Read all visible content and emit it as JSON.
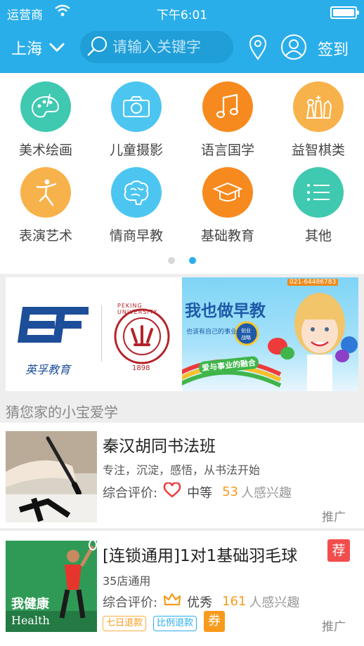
{
  "status_bar": {
    "carrier": "运营商",
    "time": "下午6:01"
  },
  "header": {
    "city": "上海",
    "search_placeholder": "请输入关键字",
    "signin": "签到"
  },
  "categories": [
    {
      "label": "美术绘画",
      "color": "#3ec9b0",
      "icon": "palette-icon"
    },
    {
      "label": "儿童摄影",
      "color": "#4cc6f0",
      "icon": "camera-icon"
    },
    {
      "label": "语言国学",
      "color": "#f78a1e",
      "icon": "music-note-icon"
    },
    {
      "label": "益智棋类",
      "color": "#f8b24b",
      "icon": "chess-icon"
    },
    {
      "label": "表演艺术",
      "color": "#f8b24b",
      "icon": "dancer-icon"
    },
    {
      "label": "情商早教",
      "color": "#4cc6f0",
      "icon": "brain-icon"
    },
    {
      "label": "基础教育",
      "color": "#f78a1e",
      "icon": "graduation-cap-icon"
    },
    {
      "label": "其他",
      "color": "#3ec9b0",
      "icon": "list-icon"
    }
  ],
  "pager": {
    "pages": 2,
    "active": 2
  },
  "banners": {
    "left": {
      "ef_caption": "英孚教育",
      "pku_arc": "PEKING UNIVERSITY",
      "pku_year": "1898"
    },
    "right": {
      "phone": "021-64486783",
      "headline": "我也做早教",
      "subline": "也该有自己的事业了",
      "badge_top": "创业",
      "badge_bottom": "战略",
      "ribbon": "爱与事业的融合"
    }
  },
  "section_title": "猜您家的小宝爱学",
  "listings": [
    {
      "title": "秦汉胡同书法班",
      "description": "专注，沉淀，感悟，从书法开始",
      "rating_label": "综合评价:",
      "rating_icon": "heart-icon",
      "rating_value": "中等",
      "interest_count": "53",
      "interest_text": "人感兴趣",
      "promo": "推广"
    },
    {
      "title": "[连锁通用]1对1基础羽毛球",
      "description": "35店通用",
      "rating_label": "综合评价:",
      "rating_icon": "crown-icon",
      "rating_value": "优秀",
      "interest_count": "161",
      "interest_text": "人感兴趣",
      "promo": "推广",
      "badge": "荐",
      "tags": [
        "七日退款",
        "比例退款"
      ],
      "coupon": "券",
      "thumb_text": "我健康",
      "thumb_sub": "Health"
    }
  ],
  "colors": {
    "primary": "#2aaeea",
    "accent_orange": "#f89a1c",
    "badge_red": "#f24d4d"
  }
}
